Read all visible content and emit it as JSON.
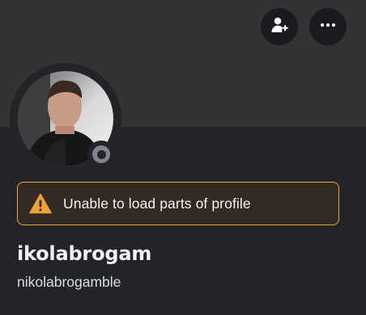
{
  "banner": {
    "color": "#333333"
  },
  "header_actions": {
    "add_friend_icon": "person-add-icon",
    "more_icon": "more-horizontal-icon"
  },
  "avatar": {
    "status": "offline",
    "status_color": "#80848e"
  },
  "warning": {
    "icon": "warning-triangle-icon",
    "text": "Unable to load parts of profile",
    "border_color": "#e6a537"
  },
  "profile": {
    "display_name": "ikolabrogam",
    "username": "nikolabrogamble"
  }
}
